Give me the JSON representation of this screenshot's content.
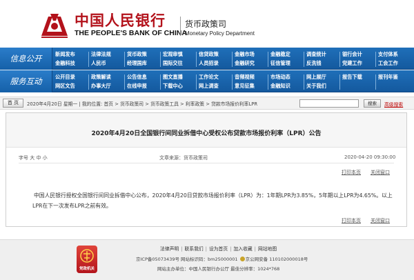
{
  "header": {
    "bank_cn": "中国人民银行",
    "bank_en": "THE PEOPLE'S BANK OF CHINA",
    "dept_cn": "货币政策司",
    "dept_en": "Monetary Policy Department",
    "brand_color": "#b3121b"
  },
  "nav": {
    "row1_label": "信息公开",
    "row2_label": "服务互动",
    "row1": [
      [
        "新闻发布",
        "金融科技"
      ],
      [
        "法律法规",
        "人民币"
      ],
      [
        "货币政策",
        "经理国库"
      ],
      [
        "宏观审慎",
        "国际交往"
      ],
      [
        "信贷政策",
        "人员招录"
      ],
      [
        "金融市场",
        "金融研究"
      ],
      [
        "金融稳定",
        "征信管理"
      ],
      [
        "调查统计",
        "反洗钱"
      ],
      [
        "银行会计",
        "党建工作"
      ],
      [
        "支付体系",
        "工会工作"
      ]
    ],
    "row2": [
      [
        "公开目录",
        "网区文告"
      ],
      [
        "政策解读",
        "办事大厅"
      ],
      [
        "公告信息",
        "在线申报"
      ],
      [
        "图文直播",
        "下载中心"
      ],
      [
        "工作论文",
        "网上调查"
      ],
      [
        "音频视频",
        "意见征集"
      ],
      [
        "市场动态",
        "金融知识"
      ],
      [
        "网上展厅",
        "关于我们"
      ],
      [
        "报告下载",
        ""
      ],
      [
        "报刊年鉴",
        ""
      ]
    ],
    "bg_color": "#1a65ad"
  },
  "searchbar": {
    "home_label": "首 页",
    "date": "2020年4月20日 星期一",
    "crumbs": "| 我的位置: 首页 > 货币政策司 > 货币政策工具 > 利率政策 > 贷款市场报价利率LPR",
    "search_value": "",
    "search_button": "搜索",
    "advanced_search": "高级搜索"
  },
  "article": {
    "title": "2020年4月20日全国银行间同业拆借中心受权公布贷款市场报价利率（LPR）公告",
    "size_label": "字号 大 中 小",
    "source_label": "文章来源：货币政策司",
    "time": "2020-04-20 09:30:00",
    "print_label": "打印本页",
    "close_label": "关闭窗口",
    "paragraph": "中国人民银行授权全国银行间同业拆借中心公布，2020年4月20日贷款市场报价利率（LPR）为：1年期LPR为3.85%，5年期以上LPR为4.65%。以上LPR在下一次发布LPR之前有效。"
  },
  "footer": {
    "logo_label": "党政机关",
    "links": [
      "法律声明",
      "联系我们",
      "设为首页",
      "加入收藏",
      "网站地图"
    ],
    "icp": "京ICP备05073439号  网站标识码：bm25000001",
    "police": "京公网安备 110102000018号",
    "org": "网站主办单位：中国人民银行办公厅  最佳分辨率：1024*768"
  }
}
